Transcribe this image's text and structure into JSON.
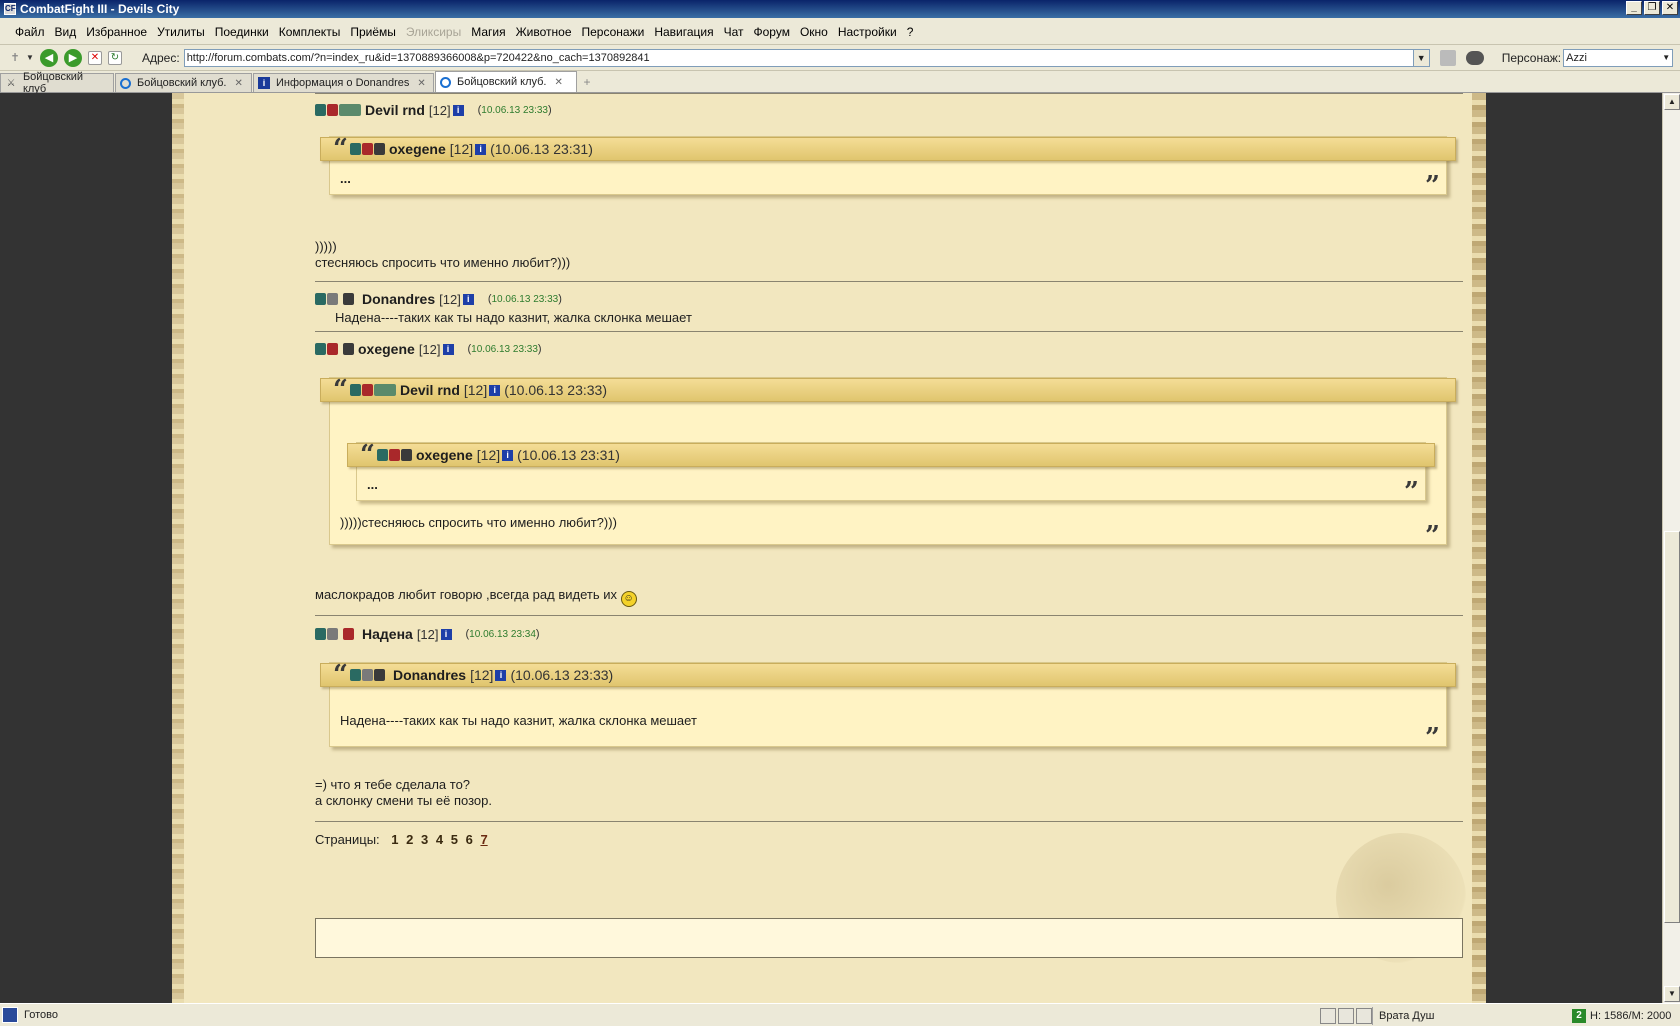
{
  "window": {
    "title": "CombatFight III - Devils City",
    "controls": [
      "_",
      "❐",
      "✕"
    ]
  },
  "menu": [
    {
      "label": "Файл",
      "enabled": true
    },
    {
      "label": "Вид",
      "enabled": true
    },
    {
      "label": "Избранное",
      "enabled": true
    },
    {
      "label": "Утилиты",
      "enabled": true
    },
    {
      "label": "Поединки",
      "enabled": true
    },
    {
      "label": "Комплекты",
      "enabled": true
    },
    {
      "label": "Приёмы",
      "enabled": true
    },
    {
      "label": "Эликсиры",
      "enabled": false
    },
    {
      "label": "Магия",
      "enabled": true
    },
    {
      "label": "Животное",
      "enabled": true
    },
    {
      "label": "Персонажи",
      "enabled": true
    },
    {
      "label": "Навигация",
      "enabled": true
    },
    {
      "label": "Чат",
      "enabled": true
    },
    {
      "label": "Форум",
      "enabled": true
    },
    {
      "label": "Окно",
      "enabled": true
    },
    {
      "label": "Настройки",
      "enabled": true
    },
    {
      "label": "?",
      "enabled": true
    }
  ],
  "address": {
    "label": "Адрес:",
    "url": "http://forum.combats.com/?n=index_ru&id=1370889366008&p=720422&no_cach=1370892841",
    "persona_label": "Персонаж:",
    "persona_value": "Azzi"
  },
  "tabs": [
    {
      "label": "Бойцовский клуб",
      "icon": "swords-icon",
      "active": false
    },
    {
      "label": "Бойцовский клуб.",
      "icon": "ie-icon",
      "active": false
    },
    {
      "label": "Информация о Donandres",
      "icon": "info-icon",
      "active": false
    },
    {
      "label": "Бойцовский клуб.",
      "icon": "ie-icon",
      "active": true
    }
  ],
  "posts": {
    "p1": {
      "author": "Devil rnd",
      "level": "[12]",
      "timestamp": "10.06.13 23:33",
      "quote": {
        "author": "oxegene",
        "level": "[12]",
        "timestamp": "(10.06.13 23:31)",
        "text": "..."
      },
      "line1": ")))))",
      "line2": "стесняюсь спросить что именно любит?)))"
    },
    "p2": {
      "author": "Donandres",
      "level": "[12]",
      "timestamp": "10.06.13 23:33",
      "text": "Надена----таких как ты надо казнит, жалка склонка мешает"
    },
    "p3": {
      "author": "oxegene",
      "level": "[12]",
      "timestamp": "10.06.13 23:33",
      "quote": {
        "author": "Devil rnd",
        "level": "[12]",
        "timestamp": "(10.06.13 23:33)",
        "inner": {
          "author": "oxegene",
          "level": "[12]",
          "timestamp": "(10.06.13 23:31)",
          "text": "..."
        },
        "text": ")))))стесняюсь спросить что именно любит?)))"
      },
      "text": "маслокрадов любит говорю ,всегда рад видеть их"
    },
    "p4": {
      "author": "Надена",
      "level": "[12]",
      "timestamp": "10.06.13 23:34",
      "quote": {
        "author": "Donandres",
        "level": "[12]",
        "timestamp": "(10.06.13 23:33)",
        "text": "Надена----таких как ты надо казнит, жалка склонка мешает"
      },
      "line1": "=) что я тебе сделала то?",
      "line2": "а склонку смени ты её позор."
    }
  },
  "pagination": {
    "label": "Страницы:",
    "pages": [
      "1",
      "2",
      "3",
      "4",
      "5",
      "6",
      "7"
    ],
    "current": "7"
  },
  "status": {
    "text": "Готово",
    "zone": "Врата Душ",
    "z_label": "2",
    "hp": "H: 1586/M: 2000"
  },
  "colors": {
    "parchment": "#f2e7bf",
    "quote_header": "#e8cf7e",
    "timestamp_green": "#2e7c2e",
    "background_dark": "#333333"
  }
}
